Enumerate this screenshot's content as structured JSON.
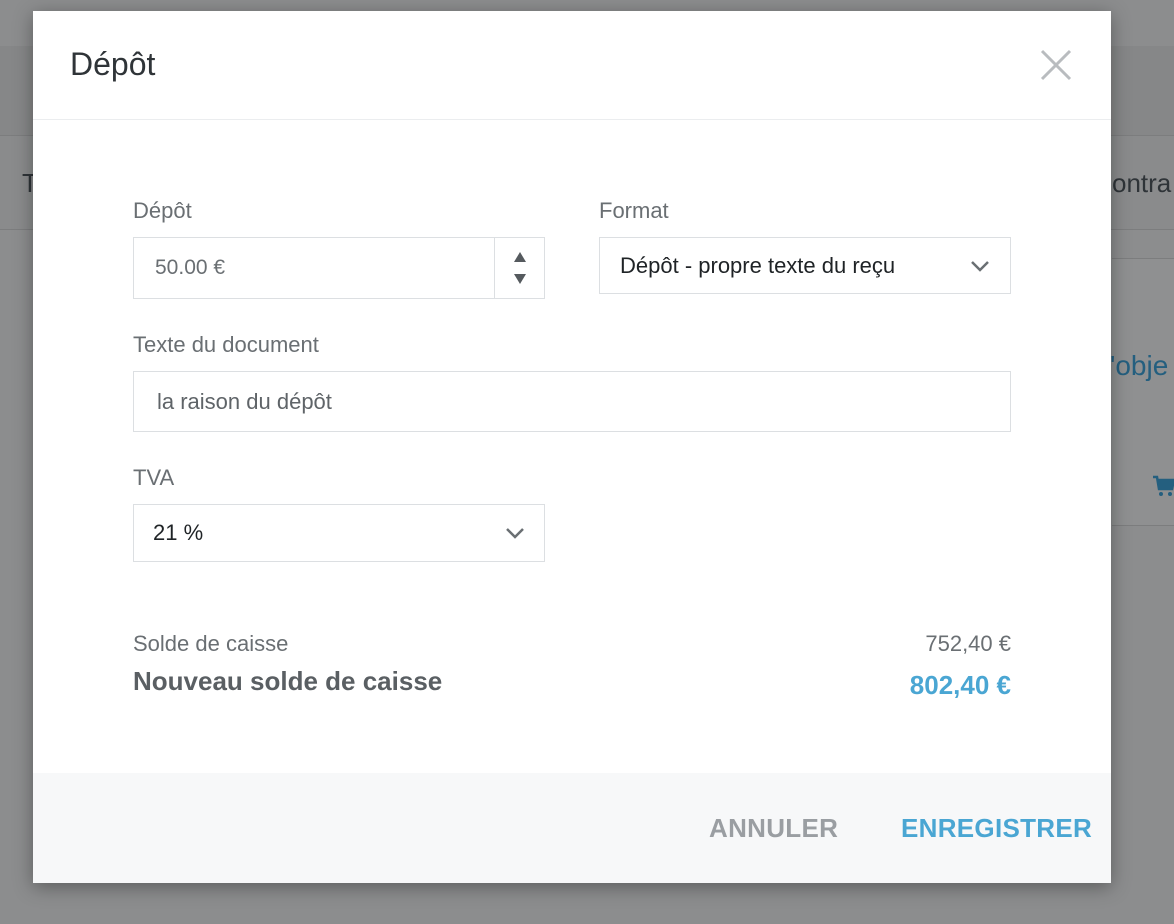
{
  "background": {
    "left_text": "T",
    "right_text": "ontra",
    "object_link": "'obje",
    "cart_icon": "cart-icon"
  },
  "modal": {
    "title": "Dépôt",
    "close_icon": "close-icon"
  },
  "form": {
    "deposit": {
      "label": "Dépôt",
      "value": "50.00 €",
      "stepper_up_icon": "triangle-up-icon",
      "stepper_down_icon": "triangle-down-icon"
    },
    "format": {
      "label": "Format",
      "selected": "Dépôt - propre texte du reçu",
      "chevron_icon": "chevron-down-icon"
    },
    "document_text": {
      "label": "Texte du document",
      "value": "la raison du dépôt"
    },
    "vat": {
      "label": "TVA",
      "selected": "21 %",
      "chevron_icon": "chevron-down-icon"
    }
  },
  "summary": {
    "cash_balance_label": "Solde de caisse",
    "cash_balance_value": "752,40 €",
    "new_cash_balance_label": "Nouveau solde de caisse",
    "new_cash_balance_value": "802,40 €"
  },
  "footer": {
    "cancel_label": "ANNULER",
    "save_label": "ENREGISTRER"
  },
  "colors": {
    "accent": "#4aa6d3",
    "overlay": "#8c8d8e",
    "footer_bg": "#f7f8f9",
    "border": "#dcdfe2"
  }
}
